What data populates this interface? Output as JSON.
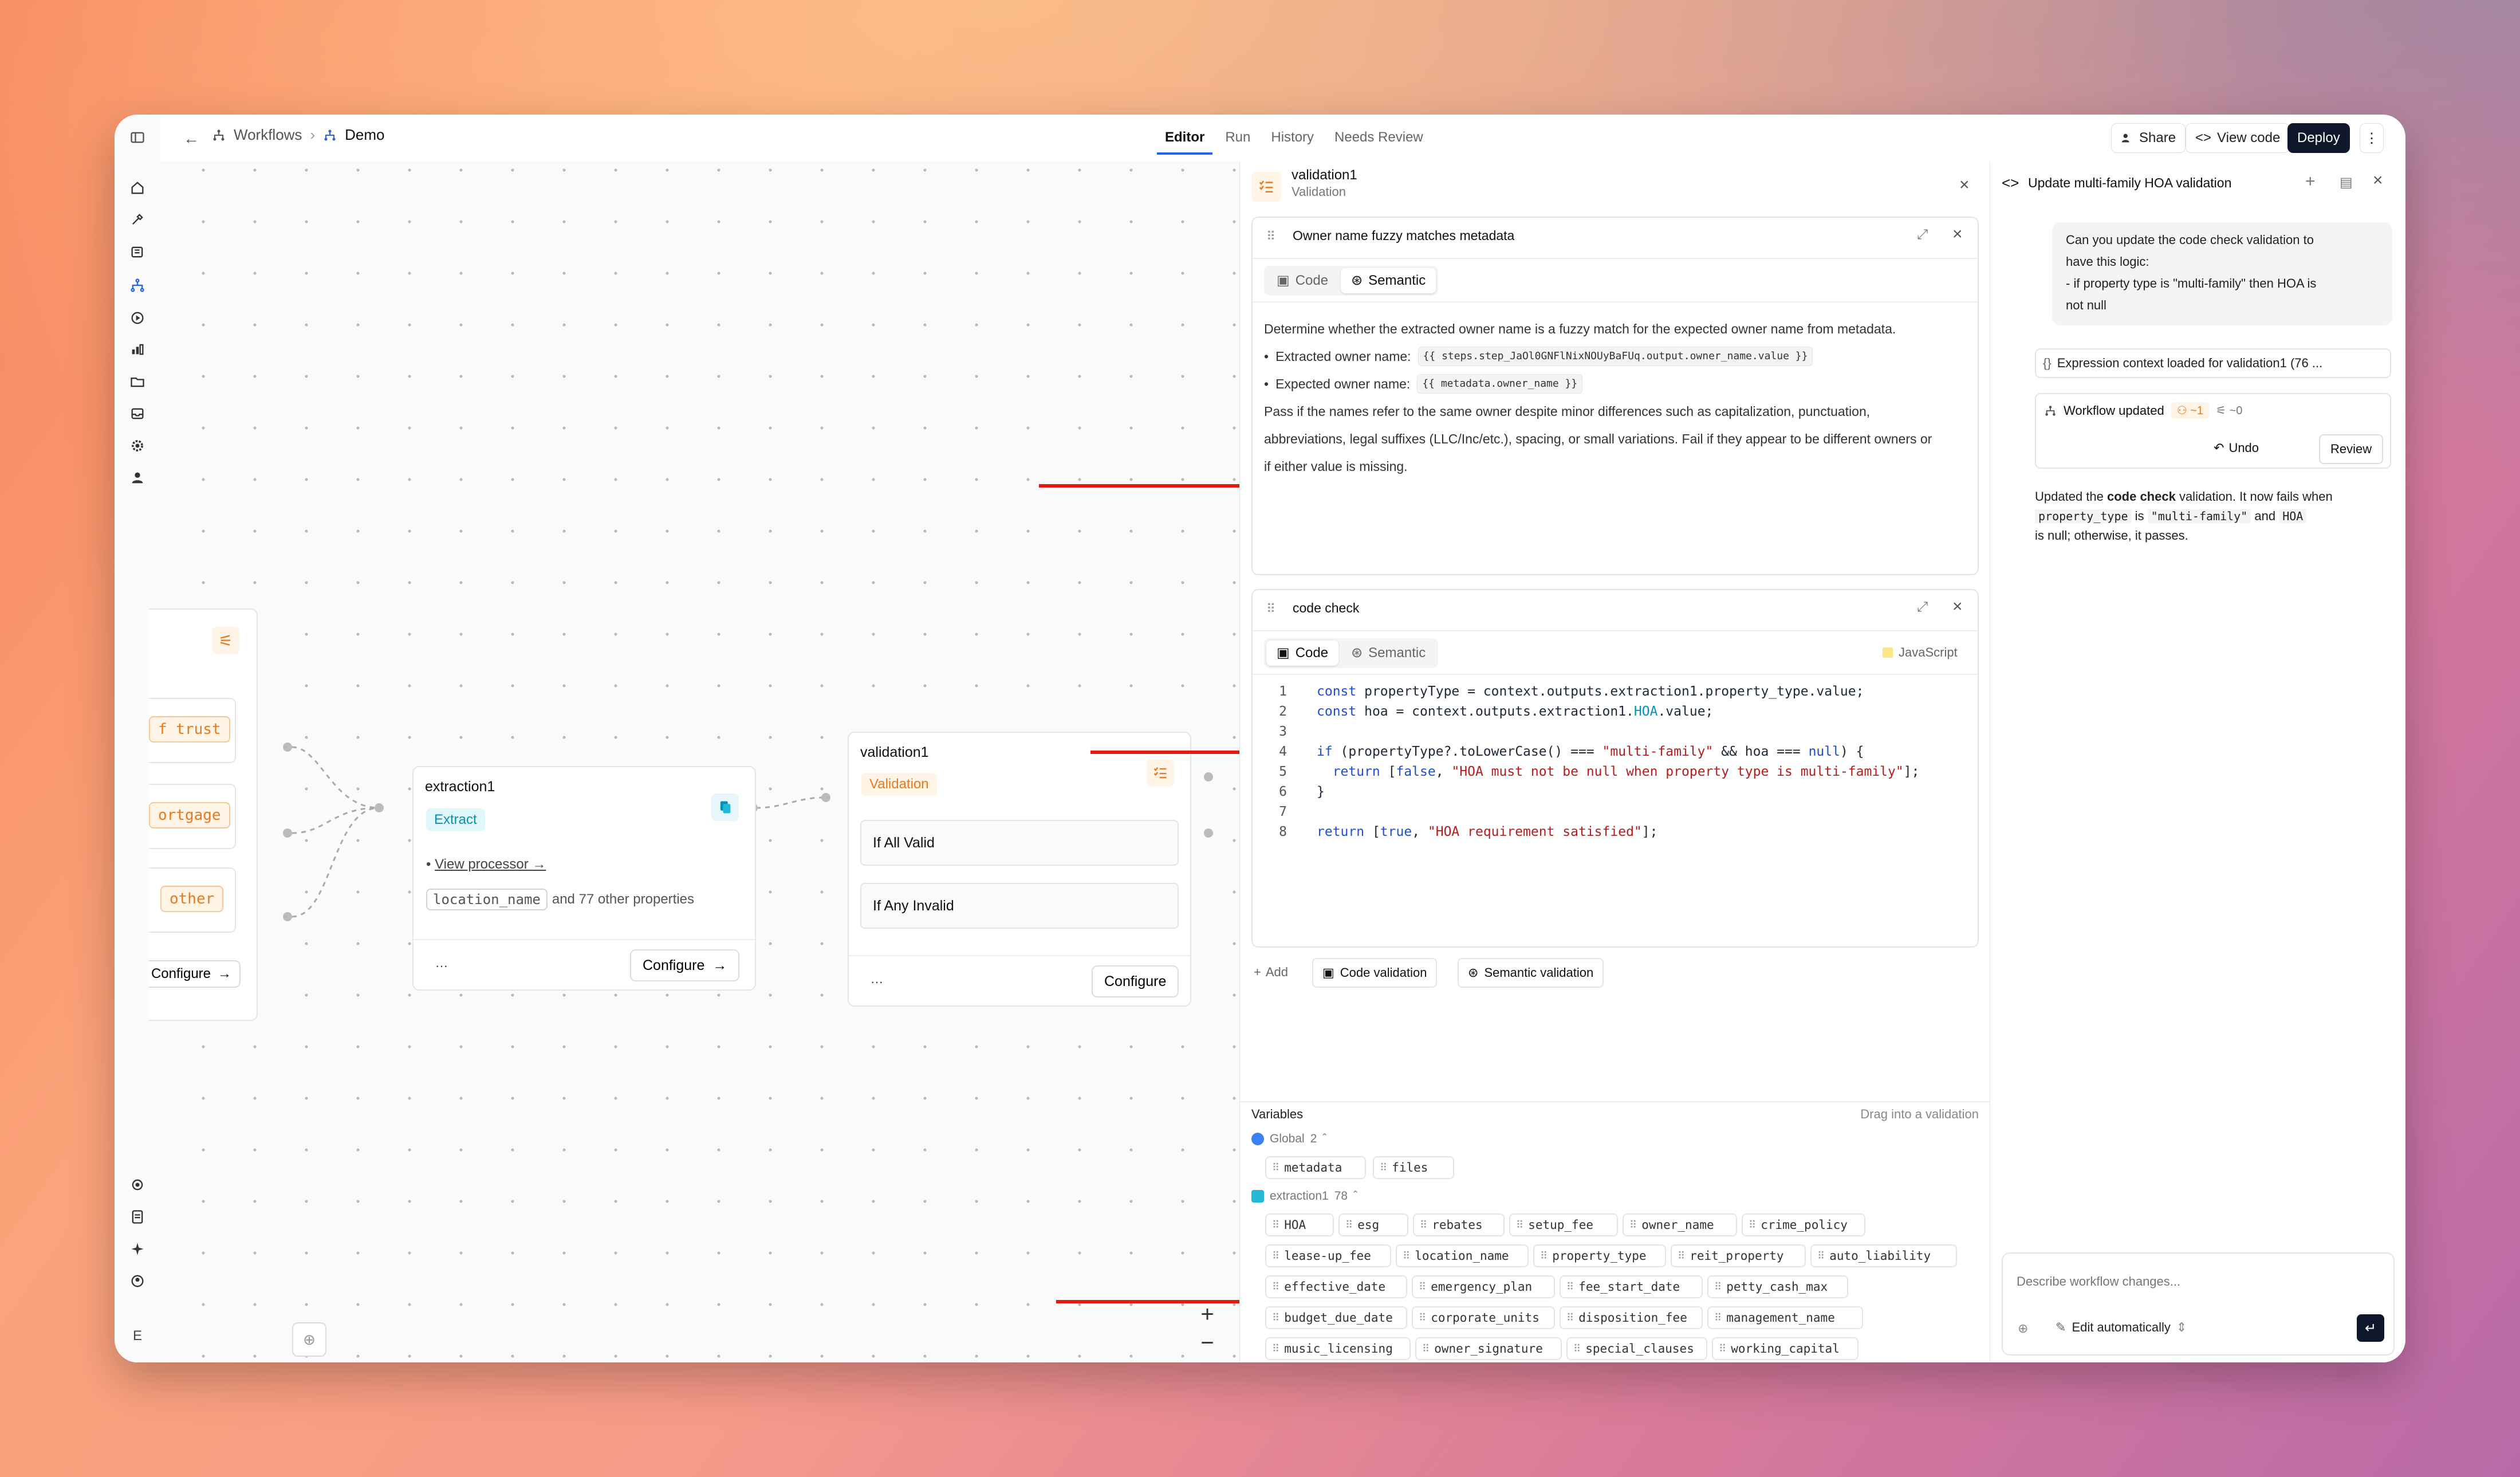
{
  "topbar": {
    "crumb_root": "Workflows",
    "crumb_current": "Demo",
    "tabs": [
      "Editor",
      "Run",
      "History",
      "Needs Review"
    ],
    "share": "Share",
    "view_code": "View code",
    "deploy": "Deploy"
  },
  "rail": {
    "footer_letter": "E"
  },
  "canvas": {
    "left_node": {
      "outputs": [
        "f trust",
        "ortgage",
        "other"
      ],
      "configure": "Configure"
    },
    "extraction_node": {
      "title": "extraction1",
      "badge": "Extract",
      "link_prefix": "• ",
      "link": "View processor →",
      "chip": "location_name",
      "more": "and 77 other properties",
      "dots": "···",
      "configure": "Configure"
    },
    "validation_node": {
      "title": "validation1",
      "badge": "Validation",
      "branch1": "If All Valid",
      "branch2": "If Any Invalid",
      "dots": "···",
      "configure": "Configure"
    }
  },
  "validation_panel": {
    "title": "validation1",
    "subtitle": "Validation",
    "card1": {
      "title": "Owner name fuzzy matches metadata",
      "tab_code": "Code",
      "tab_semantic": "Semantic",
      "intro": "Determine whether the extracted owner name is a fuzzy match for the expected owner name from metadata.",
      "bullet1_label": "Extracted owner name:",
      "bullet1_code": "{{ steps.step_JaOl0GNFlNixNOUyBaFUq.output.owner_name.value }}",
      "bullet2_label": "Expected owner name:",
      "bullet2_code": "{{ metadata.owner_name }}",
      "para_line1": "Pass if the names refer to the same owner despite minor differences such as capitalization, punctuation,",
      "para_line2": "abbreviations, legal suffixes (LLC/Inc/etc.), spacing, or small variations. Fail if they appear to be different owners or",
      "para_line3": "if either value is missing."
    },
    "card2": {
      "title": "code check",
      "tab_code": "Code",
      "tab_semantic": "Semantic",
      "language": "JavaScript",
      "line_numbers": [
        "1",
        "2",
        "3",
        "4",
        "5",
        "6",
        "7",
        "8"
      ],
      "code": {
        "l1a": "const",
        "l1b": " propertyType = context.outputs.extraction1.property_type.value;",
        "l2a": "const",
        "l2b": " hoa = context.outputs.extraction1.",
        "l2c": "HOA",
        "l2d": ".value;",
        "l4a": "if",
        "l4b": " (propertyType?.toLowerCase() === ",
        "l4c": "\"multi-family\"",
        "l4d": " && hoa === ",
        "l4e": "null",
        "l4f": ") {",
        "l5a": "  return",
        "l5b": " [",
        "l5c": "false",
        "l5d": ", ",
        "l5e": "\"HOA must not be null when property type is multi-family\"",
        "l5f": "];",
        "l6": "}",
        "l8a": "return",
        "l8b": " [",
        "l8c": "true",
        "l8d": ", ",
        "l8e": "\"HOA requirement satisfied\"",
        "l8f": "];"
      }
    },
    "add_label": "Add",
    "add_code": "Code validation",
    "add_semantic": "Semantic validation",
    "variables": {
      "title": "Variables",
      "hint": "Drag into a validation",
      "global_label": "Global",
      "global_count": "2",
      "global_vars": [
        "metadata",
        "files"
      ],
      "extraction_label": "extraction1",
      "extraction_count": "78",
      "rows": [
        [
          "HOA",
          "esg",
          "rebates",
          "setup_fee",
          "owner_name",
          "crime_policy"
        ],
        [
          "lease-up_fee",
          "location_name",
          "property_type",
          "reit_property",
          "auto_liability"
        ],
        [
          "effective_date",
          "emergency_plan",
          "fee_start_date",
          "petty_cash_max"
        ],
        [
          "budget_due_date",
          "corporate_units",
          "disposition_fee",
          "management_name"
        ],
        [
          "music_licensing",
          "owner_signature",
          "special_clauses",
          "working_capital"
        ]
      ]
    }
  },
  "chat_panel": {
    "title": "Update multi-family HOA validation",
    "user_msg_l1": "Can you update the code check validation to",
    "user_msg_l2": "have this logic:",
    "user_msg_l3": "- if property type is \"multi-family\" then HOA is",
    "user_msg_l4": "not null",
    "context_loaded": "Expression context loaded for validation1 (76 ...",
    "workflow_updated": "Workflow updated",
    "diff_minus": "~1",
    "diff_plus": "~0",
    "undo": "Undo",
    "review": "Review",
    "reply_a": "Updated the ",
    "reply_b": "code check",
    "reply_c": " validation. It now fails when",
    "reply_d": "property_type",
    "reply_e": " is ",
    "reply_f": "\"multi-family\"",
    "reply_g": " and ",
    "reply_h": "HOA",
    "reply_i": "is null; otherwise, it passes.",
    "input_placeholder": "Describe workflow changes...",
    "mode": "Edit automatically"
  },
  "colors": {
    "accent": "#2563eb",
    "orange": "#ea7a1c",
    "teal": "#0891b2",
    "red_arrow": "#e11d12"
  }
}
